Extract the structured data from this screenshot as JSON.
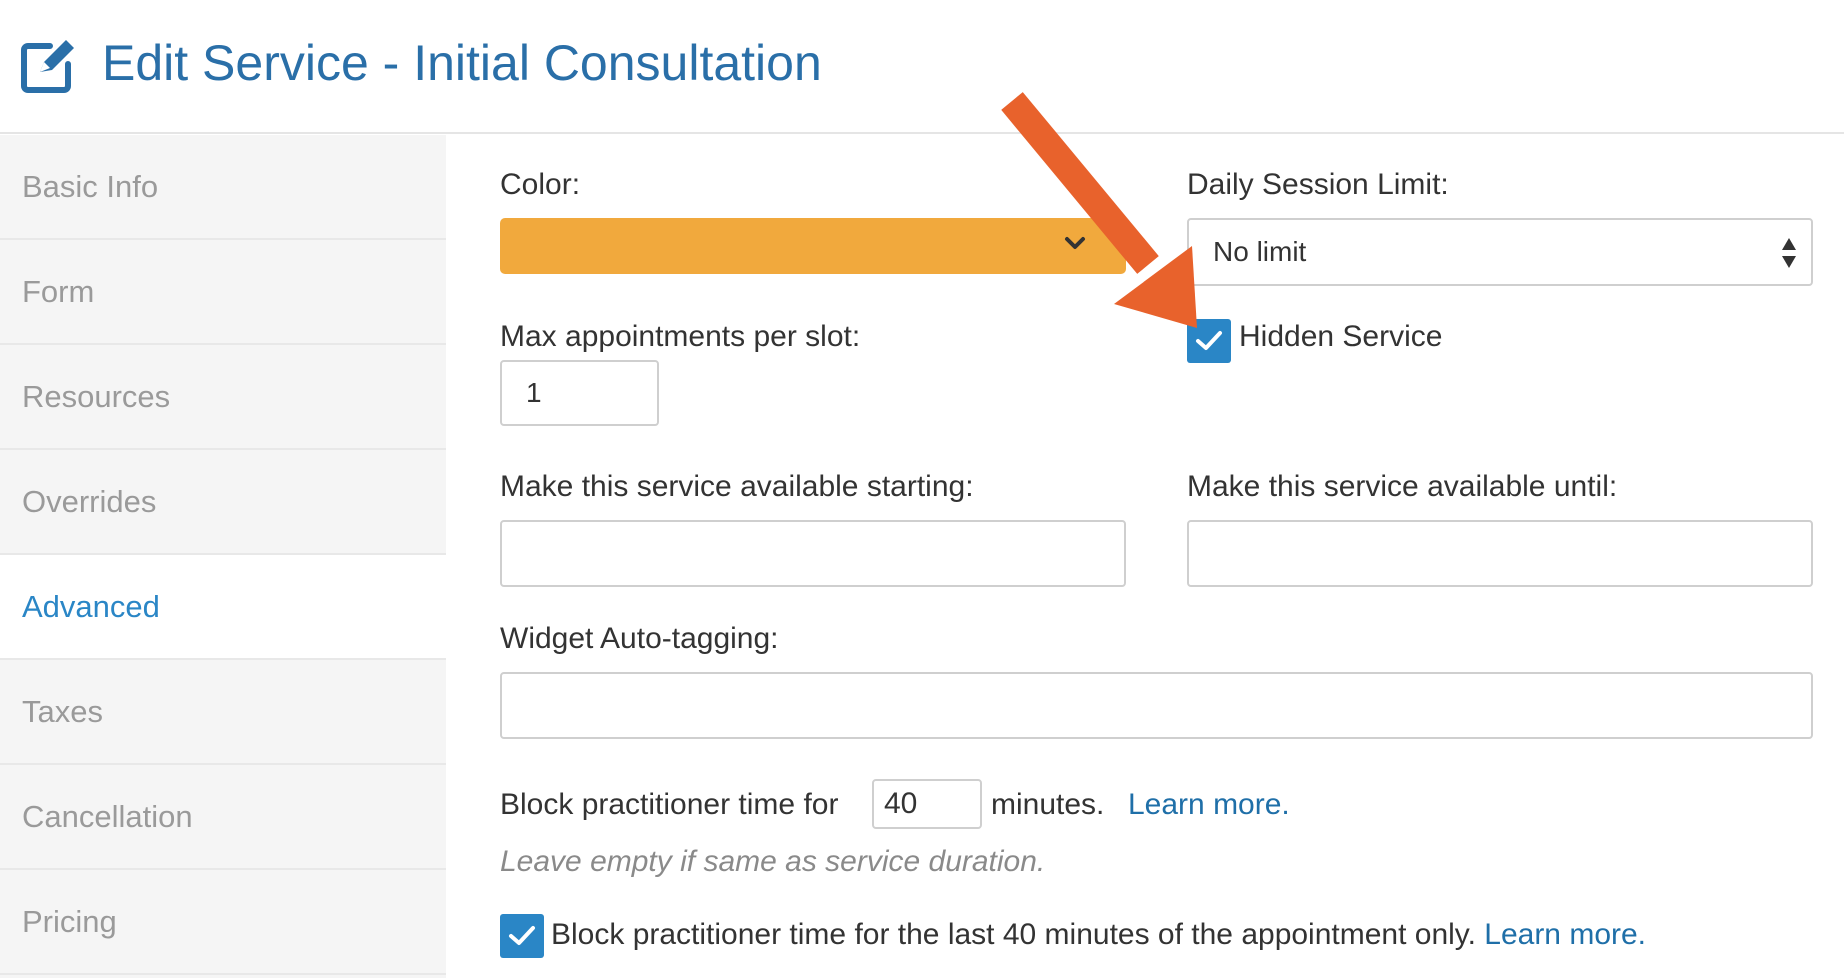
{
  "header": {
    "title": "Edit Service - Initial Consultation",
    "icon": "edit-icon",
    "title_color": "#2a6fa8"
  },
  "sidebar": {
    "items": [
      {
        "label": "Basic Info",
        "active": false
      },
      {
        "label": "Form",
        "active": false
      },
      {
        "label": "Resources",
        "active": false
      },
      {
        "label": "Overrides",
        "active": false
      },
      {
        "label": "Advanced",
        "active": true
      },
      {
        "label": "Taxes",
        "active": false
      },
      {
        "label": "Cancellation",
        "active": false
      },
      {
        "label": "Pricing",
        "active": false
      }
    ]
  },
  "form": {
    "color": {
      "label": "Color:",
      "value_color": "#f1a93d"
    },
    "daily_limit": {
      "label": "Daily Session Limit:",
      "value": "No limit"
    },
    "max_appointments": {
      "label": "Max appointments per slot:",
      "value": "1"
    },
    "hidden_service": {
      "label": "Hidden Service",
      "checked": true
    },
    "available_starting": {
      "label": "Make this service available starting:",
      "value": ""
    },
    "available_until": {
      "label": "Make this service available until:",
      "value": ""
    },
    "auto_tagging": {
      "label": "Widget Auto-tagging:",
      "value": ""
    },
    "block_time": {
      "prefix": "Block practitioner time for",
      "value": "40",
      "suffix": "minutes.",
      "link": "Learn more.",
      "hint": "Leave empty if same as service duration."
    },
    "block_last": {
      "label": "Block practitioner time for the last 40 minutes of the appointment only.",
      "link": "Learn more.",
      "checked": true
    }
  },
  "colors": {
    "accent": "#2a86c6",
    "annotation_arrow": "#e8622c"
  }
}
